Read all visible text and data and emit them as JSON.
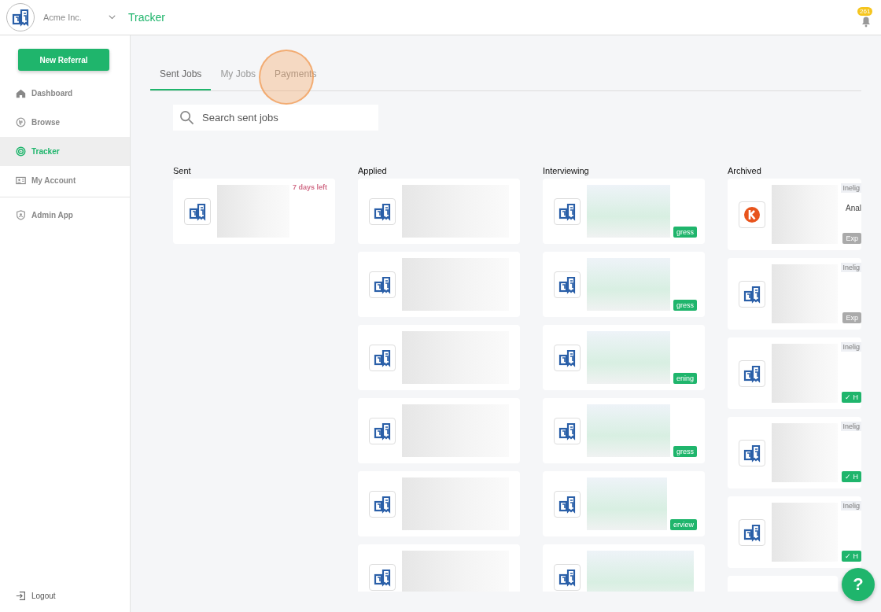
{
  "header": {
    "company": "Acme Inc.",
    "page_title": "Tracker",
    "notification_count": "261"
  },
  "sidebar": {
    "primary_button": "New Referral",
    "items": [
      {
        "label": "Dashboard",
        "selected": false,
        "divider_after": false
      },
      {
        "label": "Browse",
        "selected": false,
        "divider_after": false
      },
      {
        "label": "Tracker",
        "selected": true,
        "divider_after": false
      },
      {
        "label": "My Account",
        "selected": false,
        "divider_after": true
      },
      {
        "label": "Admin App",
        "selected": false,
        "divider_after": false
      }
    ],
    "logout": "Logout"
  },
  "tabs": [
    {
      "label": "Sent Jobs",
      "selected": true,
      "highlighted": false
    },
    {
      "label": "My Jobs",
      "selected": false,
      "highlighted": false
    },
    {
      "label": "Payments",
      "selected": false,
      "highlighted": true
    }
  ],
  "search": {
    "placeholder": "Search sent jobs"
  },
  "columns": [
    {
      "title": "Sent",
      "cards": [
        {
          "kind": "building",
          "time_left": "7 days left"
        }
      ]
    },
    {
      "title": "Applied",
      "cards": [
        {
          "kind": "building"
        },
        {
          "kind": "building"
        },
        {
          "kind": "building"
        },
        {
          "kind": "building"
        },
        {
          "kind": "building"
        },
        {
          "kind": "building"
        }
      ]
    },
    {
      "title": "Interviewing",
      "cards": [
        {
          "kind": "building",
          "badge": {
            "text": "gress",
            "color": "#1fb56c"
          }
        },
        {
          "kind": "building",
          "badge": {
            "text": "gress",
            "color": "#1fb56c"
          }
        },
        {
          "kind": "building",
          "badge": {
            "text": "ening",
            "color": "#1fb56c"
          }
        },
        {
          "kind": "building",
          "badge": {
            "text": "gress",
            "color": "#1fb56c"
          }
        },
        {
          "kind": "building",
          "badge": {
            "text": "erview",
            "color": "#1fb56c"
          }
        },
        {
          "kind": "building"
        }
      ]
    },
    {
      "title": "Archived",
      "cards": [
        {
          "kind": "k",
          "tag": "Inelig",
          "note": "Anal",
          "badge": {
            "text": "Exp",
            "color": "#aaaaaa"
          }
        },
        {
          "kind": "building",
          "tag": "Inelig",
          "badge": {
            "text": "Exp",
            "color": "#aaaaaa"
          }
        },
        {
          "kind": "building",
          "tag": "Inelig",
          "badge": {
            "text": "✓ H",
            "color": "#1fb56c"
          }
        },
        {
          "kind": "building",
          "tag": "Inelig",
          "badge": {
            "text": "✓ H",
            "color": "#1fb56c"
          }
        },
        {
          "kind": "building",
          "tag": "Inelig",
          "badge": {
            "text": "✓ H",
            "color": "#1fb56c"
          }
        },
        {
          "kind": "empty"
        }
      ]
    }
  ],
  "help_button": "?"
}
